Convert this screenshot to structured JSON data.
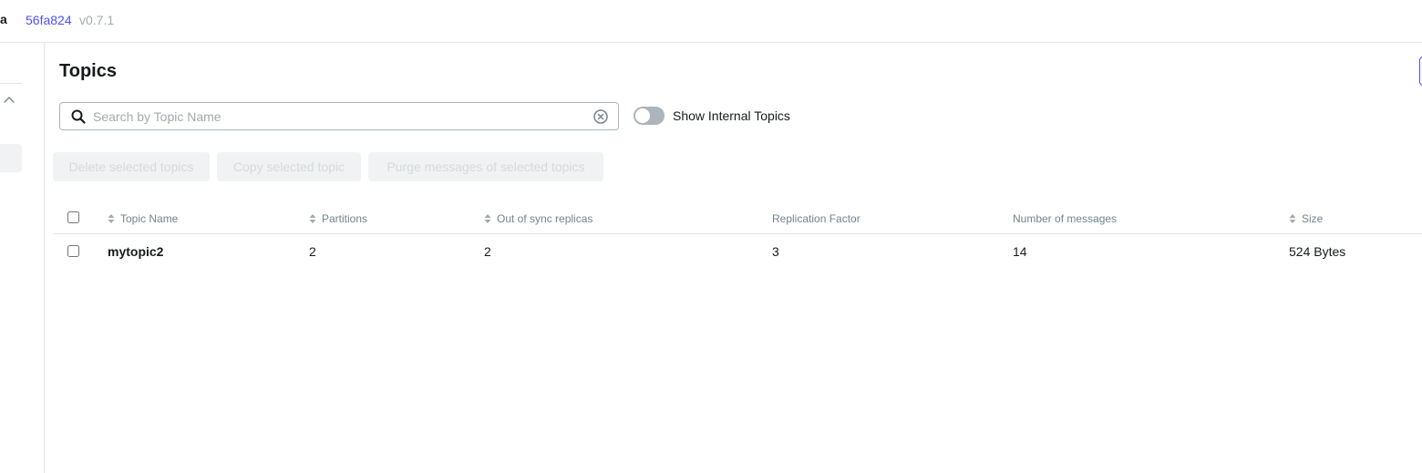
{
  "header": {
    "brand_fragment": "a",
    "commit": "56fa824",
    "version": "v0.7.1"
  },
  "page": {
    "title": "Topics"
  },
  "search": {
    "placeholder": "Search by Topic Name",
    "value": ""
  },
  "internal_toggle": {
    "label": "Show Internal Topics",
    "checked": false
  },
  "actions": {
    "delete_label": "Delete selected topics",
    "copy_label": "Copy selected topic",
    "purge_label": "Purge messages of selected topics"
  },
  "table": {
    "columns": [
      {
        "label": "Topic Name",
        "sortable": true
      },
      {
        "label": "Partitions",
        "sortable": true
      },
      {
        "label": "Out of sync replicas",
        "sortable": true
      },
      {
        "label": "Replication Factor",
        "sortable": false
      },
      {
        "label": "Number of messages",
        "sortable": false
      },
      {
        "label": "Size",
        "sortable": true
      }
    ],
    "rows": [
      {
        "name": "mytopic2",
        "partitions": "2",
        "out_of_sync": "2",
        "replication_factor": "3",
        "messages": "14",
        "size": "524 Bytes"
      }
    ]
  },
  "colors": {
    "accent": "#4f4ffa",
    "text": "#171a1c",
    "muted": "#73848c",
    "border": "#e3e6e8"
  },
  "icons": {
    "search": "search-icon",
    "clear": "clear-circle-icon",
    "sort": "sort-icon",
    "sidebar_collapse": "chevron-up-icon"
  }
}
